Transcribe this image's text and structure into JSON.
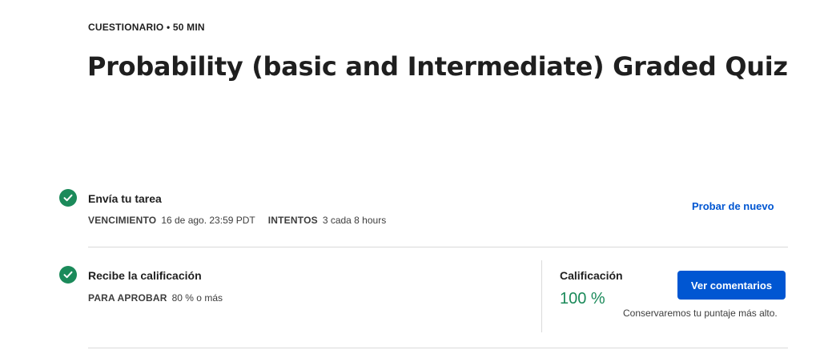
{
  "header": {
    "eyebrow": "CUESTIONARIO • 50 MIN",
    "title": "Probability (basic and Intermediate) Graded Quiz"
  },
  "steps": [
    {
      "title": "Envía tu tarea",
      "meta": [
        {
          "key": "VENCIMIENTO",
          "value": "16 de ago. 23:59 PDT"
        },
        {
          "key": "INTENTOS",
          "value": "3 cada 8 hours"
        }
      ],
      "action_label": "Probar de nuevo",
      "icon": "check-circle-icon"
    },
    {
      "title": "Recibe la calificación",
      "meta": [
        {
          "key": "PARA APROBAR",
          "value": "80 % o más"
        }
      ],
      "icon": "check-circle-icon"
    }
  ],
  "grade": {
    "label": "Calificación",
    "value": "100 %",
    "button_label": "Ver comentarios",
    "note": "Conservaremos tu puntaje más alto."
  },
  "colors": {
    "accent": "#0056d2",
    "success": "#1b8a5a",
    "divider": "#dadada"
  }
}
